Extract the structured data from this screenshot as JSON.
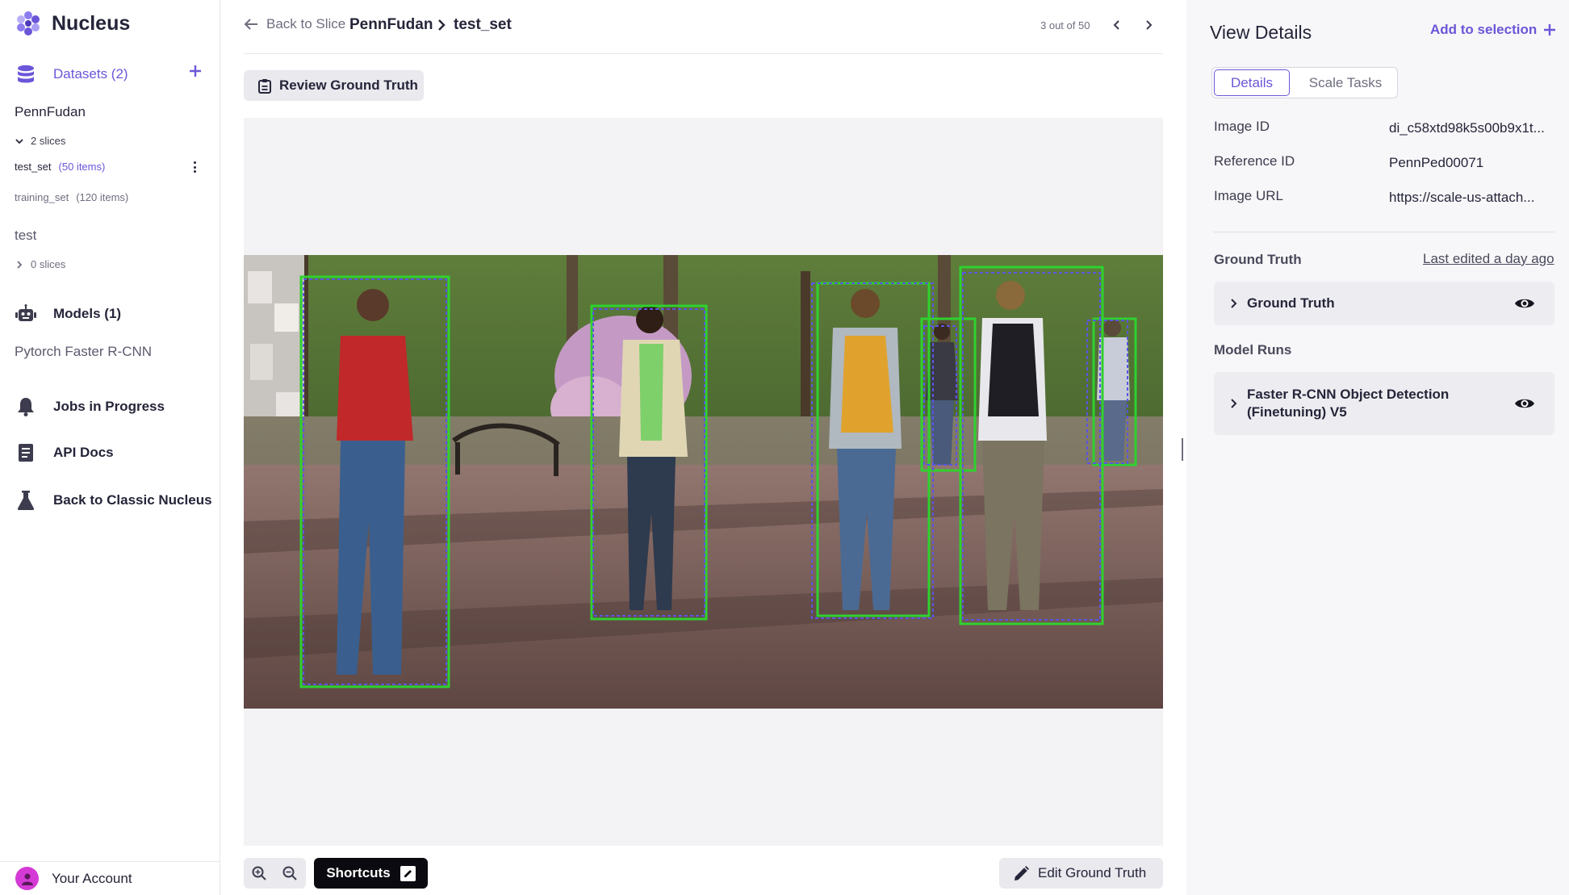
{
  "app": {
    "name": "Nucleus"
  },
  "sidebar": {
    "datasets_label": "Datasets (2)",
    "datasets": [
      {
        "name": "PennFudan",
        "slices_label": "2 slices",
        "slices": [
          {
            "name": "test_set",
            "count": "(50 items)"
          },
          {
            "name": "training_set",
            "count": "(120 items)"
          }
        ]
      },
      {
        "name": "test",
        "slices_label": "0 slices"
      }
    ],
    "models_label": "Models (1)",
    "models": [
      "Pytorch Faster R-CNN"
    ],
    "jobs_label": "Jobs in Progress",
    "api_docs_label": "API Docs",
    "classic_label": "Back to Classic Nucleus",
    "account_label": "Your Account"
  },
  "header": {
    "back_label": "Back to Slice",
    "dataset": "PennFudan",
    "slice": "test_set",
    "pager": "3 out of 50"
  },
  "toolbar": {
    "review_label": "Review Ground Truth",
    "shortcuts_label": "Shortcuts",
    "edit_label": "Edit Ground Truth"
  },
  "details": {
    "title": "View Details",
    "add_selection_label": "Add to selection",
    "tabs": [
      "Details",
      "Scale Tasks"
    ],
    "fields": [
      {
        "key": "Image ID",
        "value": "di_c58xtd98k5s00b9x1t..."
      },
      {
        "key": "Reference ID",
        "value": "PennPed00071"
      },
      {
        "key": "Image URL",
        "value": "https://scale-us-attach..."
      }
    ],
    "ground_truth_heading": "Ground Truth",
    "last_edited": "Last edited a day ago",
    "ground_truth_item": "Ground Truth",
    "model_runs_heading": "Model Runs",
    "model_run_item": "Faster R-CNN Object Detection (Finetuning) V5"
  },
  "colors": {
    "accent": "#6b56d9",
    "annotation_ground_truth": "#2fd12f",
    "annotation_prediction": "#5a55e6",
    "avatar": "#d53ad6"
  },
  "icons": [
    "logo-icon",
    "database-icon",
    "plus-icon",
    "chevron-down-icon",
    "chevron-right-icon",
    "kebab-icon",
    "robot-icon",
    "bell-icon",
    "book-icon",
    "flask-icon",
    "user-icon",
    "arrow-left-icon",
    "chevron-left-icon",
    "clipboard-icon",
    "zoom-in-icon",
    "zoom-out-icon",
    "edit-icon",
    "pencil-icon",
    "eye-icon"
  ]
}
